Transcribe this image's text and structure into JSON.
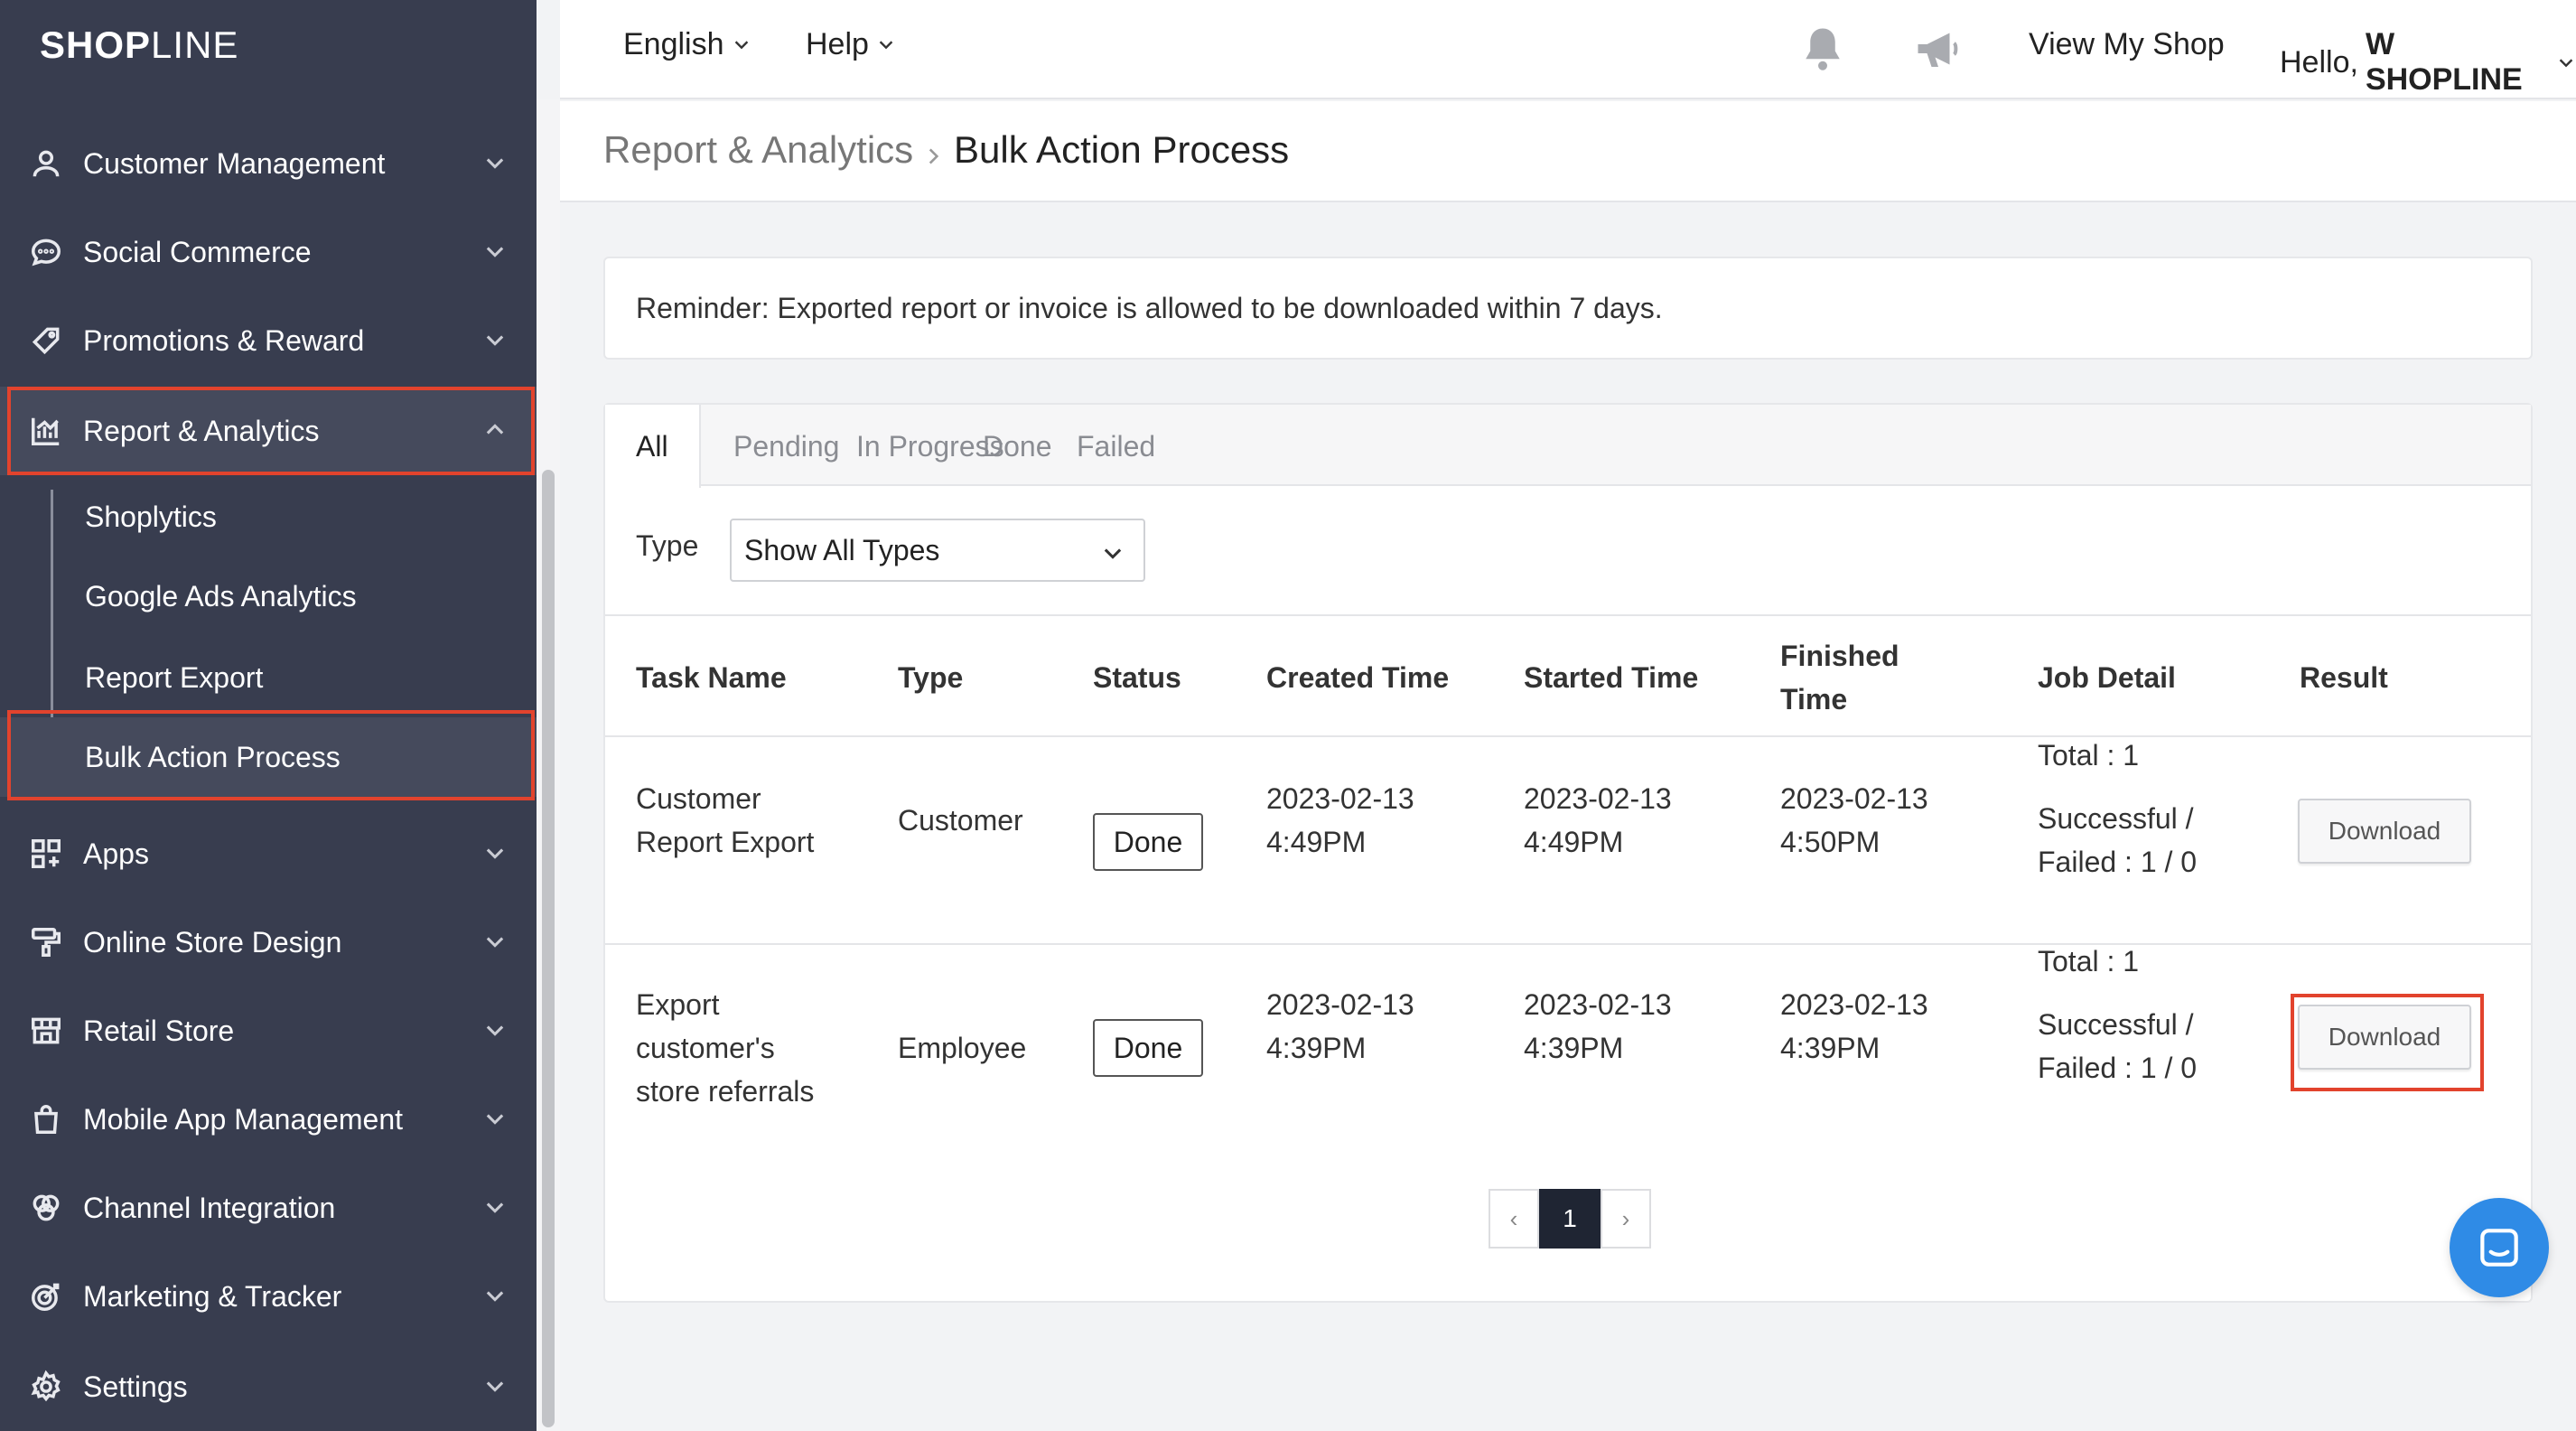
{
  "brand": {
    "name_bold_left": "SH",
    "name_bold_mid": "O",
    "name_bold_right": "P",
    "name_thin": "LINE"
  },
  "topbar": {
    "language": "English",
    "help": "Help",
    "view_shop": "View My Shop",
    "greeting": "Hello,",
    "user": "W SHOPLINE"
  },
  "sidebar": {
    "items": [
      {
        "label": "Customer Management",
        "icon": "user-icon"
      },
      {
        "label": "Social Commerce",
        "icon": "chat-bubble-icon"
      },
      {
        "label": "Promotions & Reward",
        "icon": "tag-icon"
      },
      {
        "label": "Report & Analytics",
        "icon": "chart-icon"
      },
      {
        "label": "Apps",
        "icon": "apps-grid-icon"
      },
      {
        "label": "Online Store Design",
        "icon": "paint-roller-icon"
      },
      {
        "label": "Retail Store",
        "icon": "store-icon"
      },
      {
        "label": "Mobile App Management",
        "icon": "shopping-bag-icon"
      },
      {
        "label": "Channel Integration",
        "icon": "channel-icon"
      },
      {
        "label": "Marketing & Tracker",
        "icon": "target-icon"
      },
      {
        "label": "Settings",
        "icon": "gear-icon"
      }
    ],
    "sub_items": [
      "Shoplytics",
      "Google Ads Analytics",
      "Report Export",
      "Bulk Action Process"
    ]
  },
  "breadcrumb": {
    "parent": "Report & Analytics",
    "current": "Bulk Action Process"
  },
  "reminder": "Reminder: Exported report or invoice is allowed to be downloaded within 7 days.",
  "tabs": [
    "All",
    "Pending",
    "In Progress",
    "Done",
    "Failed"
  ],
  "filter": {
    "label": "Type",
    "value": "Show All Types"
  },
  "table": {
    "headers": {
      "task_name": "Task Name",
      "type": "Type",
      "status": "Status",
      "created": "Created Time",
      "started": "Started Time",
      "finished_1": "Finished",
      "finished_2": "Time",
      "job_detail": "Job Detail",
      "result": "Result"
    },
    "rows": [
      {
        "task_1": "Customer",
        "task_2": "Report Export",
        "task_3": "",
        "type": "Customer",
        "status": "Done",
        "created_date": "2023-02-13",
        "created_time": "4:49PM",
        "started_date": "2023-02-13",
        "started_time": "4:49PM",
        "finished_date": "2023-02-13",
        "finished_time": "4:50PM",
        "total": "Total : 1",
        "succ_1": "Successful /",
        "succ_2": "Failed : 1 / 0",
        "action": "Download"
      },
      {
        "task_1": "Export",
        "task_2": "customer's",
        "task_3": "store referrals",
        "type": "Employee",
        "status": "Done",
        "created_date": "2023-02-13",
        "created_time": "4:39PM",
        "started_date": "2023-02-13",
        "started_time": "4:39PM",
        "finished_date": "2023-02-13",
        "finished_time": "4:39PM",
        "total": "Total : 1",
        "succ_1": "Successful /",
        "succ_2": "Failed : 1 / 0",
        "action": "Download"
      }
    ]
  },
  "pagination": {
    "prev": "‹",
    "page": "1",
    "next": "›"
  },
  "colors": {
    "sidebar_bg": "#383d4f",
    "highlight": "#e2432d",
    "chat": "#2f8be6",
    "page_active": "#1f2533"
  }
}
